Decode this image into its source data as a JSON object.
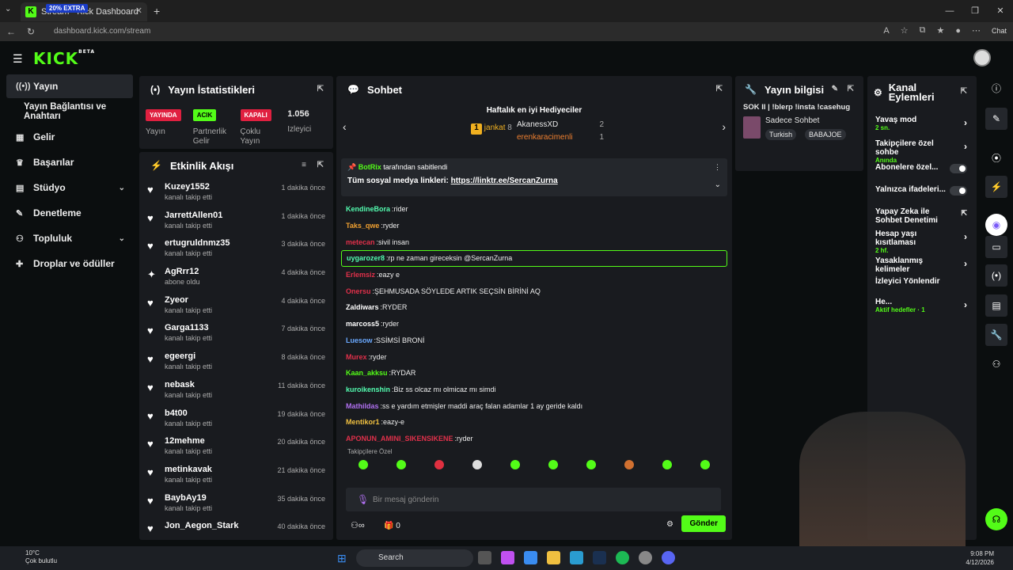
{
  "browser": {
    "tab_title": "Stream - Kick Dashboard",
    "promo_text": "20% EXTRA",
    "url": "dashboard.kick.com/stream",
    "chat_label": "Chat"
  },
  "kick": {
    "logo": "KICK",
    "beta": "BETA"
  },
  "sidebar": {
    "items": [
      {
        "label": "Yayın",
        "icon": "broadcast-icon"
      },
      {
        "label": "Yayın Bağlantısı ve Anahtarı",
        "icon": ""
      },
      {
        "label": "Gelir",
        "icon": "grid-icon"
      },
      {
        "label": "Başarılar",
        "icon": "trophy-icon"
      },
      {
        "label": "Stüdyo",
        "icon": "studio-icon"
      },
      {
        "label": "Denetleme",
        "icon": "wrench-icon"
      },
      {
        "label": "Topluluk",
        "icon": "community-icon"
      },
      {
        "label": "Droplar ve ödüller",
        "icon": "gift-icon"
      }
    ]
  },
  "stats_panel": {
    "title": "Yayın İstatistikleri",
    "stats": [
      {
        "badge": "YAYINDA",
        "label": "Yayın"
      },
      {
        "badge": "ACIK",
        "label": "Partnerlik Gelir"
      },
      {
        "badge": "KAPALI",
        "label": "Çoklu Yayın"
      },
      {
        "value": "1.056",
        "label": "İzleyici"
      }
    ]
  },
  "events_panel": {
    "title": "Etkinlik Akışı",
    "events": [
      {
        "name": "Kuzey1552",
        "action": "kanalı takip etti",
        "time": "1 dakika önce"
      },
      {
        "name": "JarrettAllen01",
        "action": "kanalı takip etti",
        "time": "1 dakika önce"
      },
      {
        "name": "ertugruldnmz35",
        "action": "kanalı takip etti",
        "time": "3 dakika önce"
      },
      {
        "name": "AgRrr12",
        "action": "abone oldu",
        "time": "4 dakika önce"
      },
      {
        "name": "Zyeor",
        "action": "kanalı takip etti",
        "time": "4 dakika önce"
      },
      {
        "name": "Garga1133",
        "action": "kanalı takip etti",
        "time": "7 dakika önce"
      },
      {
        "name": "egeergi",
        "action": "kanalı takip etti",
        "time": "8 dakika önce"
      },
      {
        "name": "nebask",
        "action": "kanalı takip etti",
        "time": "11 dakika önce"
      },
      {
        "name": "b4t00",
        "action": "kanalı takip etti",
        "time": "19 dakika önce"
      },
      {
        "name": "12mehme",
        "action": "kanalı takip etti",
        "time": "20 dakika önce"
      },
      {
        "name": "metinkavak",
        "action": "kanalı takip etti",
        "time": "21 dakika önce"
      },
      {
        "name": "BaybAy19",
        "action": "kanalı takip etti",
        "time": "35 dakika önce"
      },
      {
        "name": "Jon_Aegon_Stark",
        "action": "",
        "time": "40 dakika önce"
      }
    ]
  },
  "chat_panel": {
    "title": "Sohbet",
    "gifters_title": "Haftalık en iyi Hediyeciler",
    "gifters": [
      {
        "rank": "1",
        "name": "jankat",
        "count": "8"
      },
      {
        "name": "AkanessXD",
        "count": "2"
      },
      {
        "name": "erenkaracimenli",
        "count": "1"
      }
    ],
    "pinned_by": "BotRix",
    "pinned_suffix": "tarafından sabitlendi",
    "pinned_text": "Tüm sosyal medya linkleri:",
    "pinned_link": "https://linktr.ee/SercanZurna",
    "messages": [
      {
        "user": "KendineBora",
        "text": "rider",
        "color": "#53fcb0"
      },
      {
        "user": "Taks_qwe",
        "text": "ryder",
        "color": "#f0a030"
      },
      {
        "user": "metecan",
        "text": "sivil insan",
        "color": "#e0304a"
      },
      {
        "user": "uygarozer8",
        "text": "rp ne zaman gireceksin @SercanZurna",
        "color": "#53fcb0",
        "highlight": true
      },
      {
        "user": "Erlemsiz",
        "text": "eazy e",
        "color": "#e0304a"
      },
      {
        "user": "Onersu",
        "text": "ŞEHMUSADA SÖYLEDE ARTIK SEÇSİN BİRİNİ AQ",
        "color": "#e0304a"
      },
      {
        "user": "Zaldiwars",
        "text": "RYDER",
        "color": "#ffffff"
      },
      {
        "user": "marcoss5",
        "text": "ryder",
        "color": "#ffffff"
      },
      {
        "user": "Luesow",
        "text": "SSİMSİ BRONİ",
        "color": "#6aa9ff"
      },
      {
        "user": "Murex",
        "text": "ryder",
        "color": "#e0304a"
      },
      {
        "user": "Kaan_akksu",
        "text": "RYDAR",
        "color": "#53fc18"
      },
      {
        "user": "kuroikenshin",
        "text": "Biz ss olcaz mı olmicaz mı simdi",
        "color": "#53fcb0"
      },
      {
        "user": "Mathildas",
        "text": "ss e yardım etmişler maddi araç falan adamlar 1 ay geride kaldı",
        "color": "#b070f0"
      },
      {
        "user": "Mentikor1",
        "text": "eazy-e",
        "color": "#f0c040"
      },
      {
        "user": "APONUN_AMINI_SIKENSIKENE",
        "text": "ryder",
        "color": "#e0304a"
      }
    ],
    "emote_label": "Takipçilere Özel",
    "input_placeholder": "Bir mesaj gönderin",
    "points": "0",
    "send_label": "Gönder"
  },
  "info_panel": {
    "title": "Yayın bilgisi",
    "stream_title": "SOK II | !blerp !insta !casehug",
    "category": "Sadece Sohbet",
    "tags": [
      "Turkish",
      "BABAJOE"
    ]
  },
  "actions_panel": {
    "title": "Kanal Eylemleri",
    "items": [
      {
        "label": "Yavaş mod",
        "sub": "2 sn.",
        "control": "chevron"
      },
      {
        "label": "Takipçilere özel sohbe",
        "sub": "Anında",
        "control": "chevron"
      },
      {
        "label": "Abonelere özel...",
        "sub": "",
        "control": "toggle"
      },
      {
        "label": "Yalnızca ifadeleri...",
        "sub": "",
        "control": "toggle"
      },
      {
        "label": "Yapay Zeka ile Sohbet Denetimi",
        "sub": "",
        "control": "external"
      },
      {
        "label": "Hesap yaşı kısıtlaması",
        "sub": "2 hf.",
        "control": "chevron"
      },
      {
        "label": "Yasaklanmış kelimeler",
        "sub": "",
        "control": "chevron"
      },
      {
        "label": "İzleyici Yönlendir",
        "sub": "",
        "control": "none"
      },
      {
        "label": "He...",
        "sub": "Aktif hedefler · 1",
        "control": "chevron"
      }
    ]
  },
  "taskbar": {
    "temp": "10°C",
    "weather": "Çok bulutlu",
    "search": "Search",
    "time": "9:08 PM",
    "date": "4/12/2026"
  }
}
